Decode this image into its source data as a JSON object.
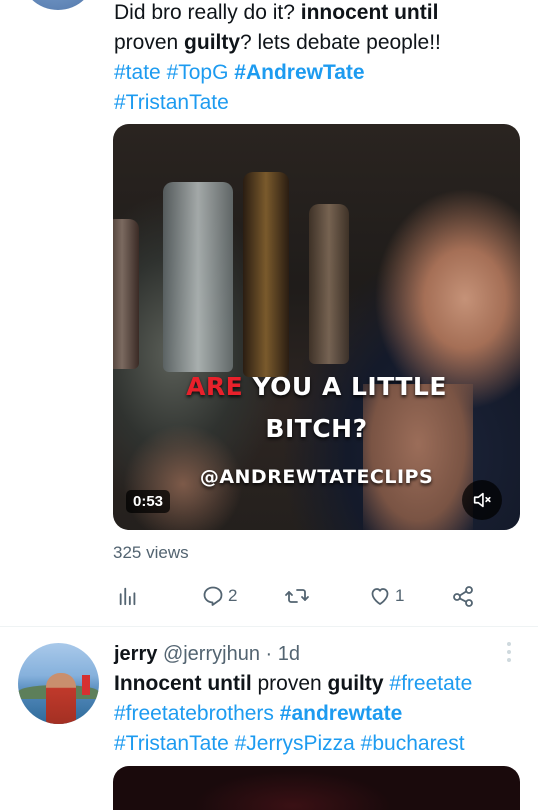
{
  "tweet1": {
    "text_parts": [
      "Did bro really do it? ",
      "innocent until",
      " proven ",
      "guilty",
      "? lets debate people!!"
    ],
    "hashtags": [
      "#tate",
      "#TopG",
      "#AndrewTate",
      "#TristanTate"
    ],
    "video": {
      "caption_red": "ARE",
      "caption_line1": " YOU A LITTLE",
      "caption_line2": "BITCH?",
      "watermark": "@ANDREWTATECLIPS",
      "duration": "0:53",
      "mute_icon": "volume-muted-icon"
    },
    "views": "325 views",
    "actions": {
      "analytics_icon": "analytics-icon",
      "reply_count": "2",
      "retweet_count": "",
      "like_count": "1",
      "share_icon": "share-icon"
    }
  },
  "tweet2": {
    "display_name": "jerry",
    "handle": "@jerryjhun",
    "separator": " · ",
    "time": "1d",
    "text_parts": [
      "Innocent until",
      " proven ",
      "guilty",
      " "
    ],
    "hashtags": [
      "#freetate",
      "#freetatebrothers",
      "#andrewtate",
      "#TristanTate",
      "#JerrysPizza",
      "#bucharest"
    ]
  },
  "colors": {
    "accent": "#1d9bf0",
    "text": "#0f1419",
    "secondary": "#536471",
    "caption_red": "#e8212b"
  }
}
